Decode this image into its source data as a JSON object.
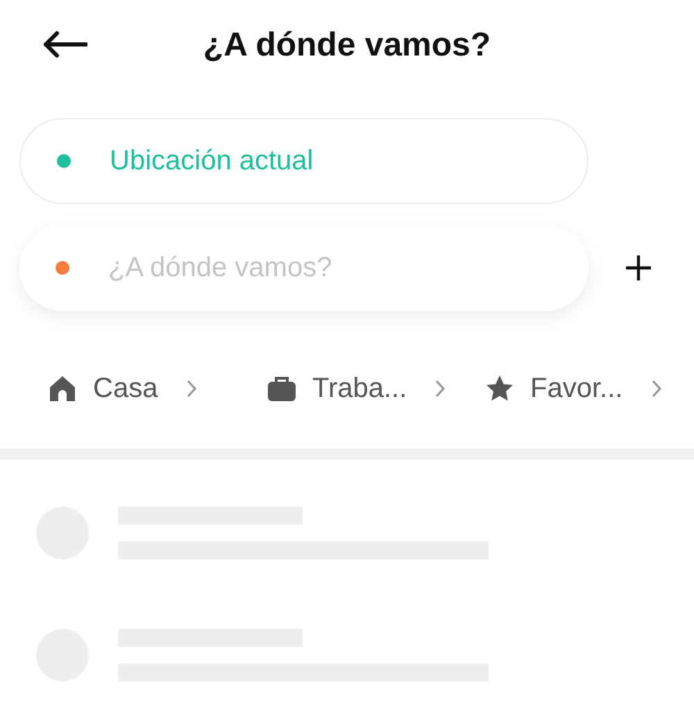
{
  "header": {
    "title": "¿A dónde vamos?"
  },
  "origin": {
    "value": "Ubicación actual",
    "color": "#1dbf9c"
  },
  "destination": {
    "placeholder": "¿A dónde vamos?",
    "color": "#f47c3c"
  },
  "shortcuts": [
    {
      "kind": "home",
      "label": "Casa"
    },
    {
      "kind": "work",
      "label": "Traba..."
    },
    {
      "kind": "star",
      "label": "Favor..."
    }
  ],
  "results": [
    {
      "kind": "skeleton"
    },
    {
      "kind": "skeleton"
    }
  ]
}
